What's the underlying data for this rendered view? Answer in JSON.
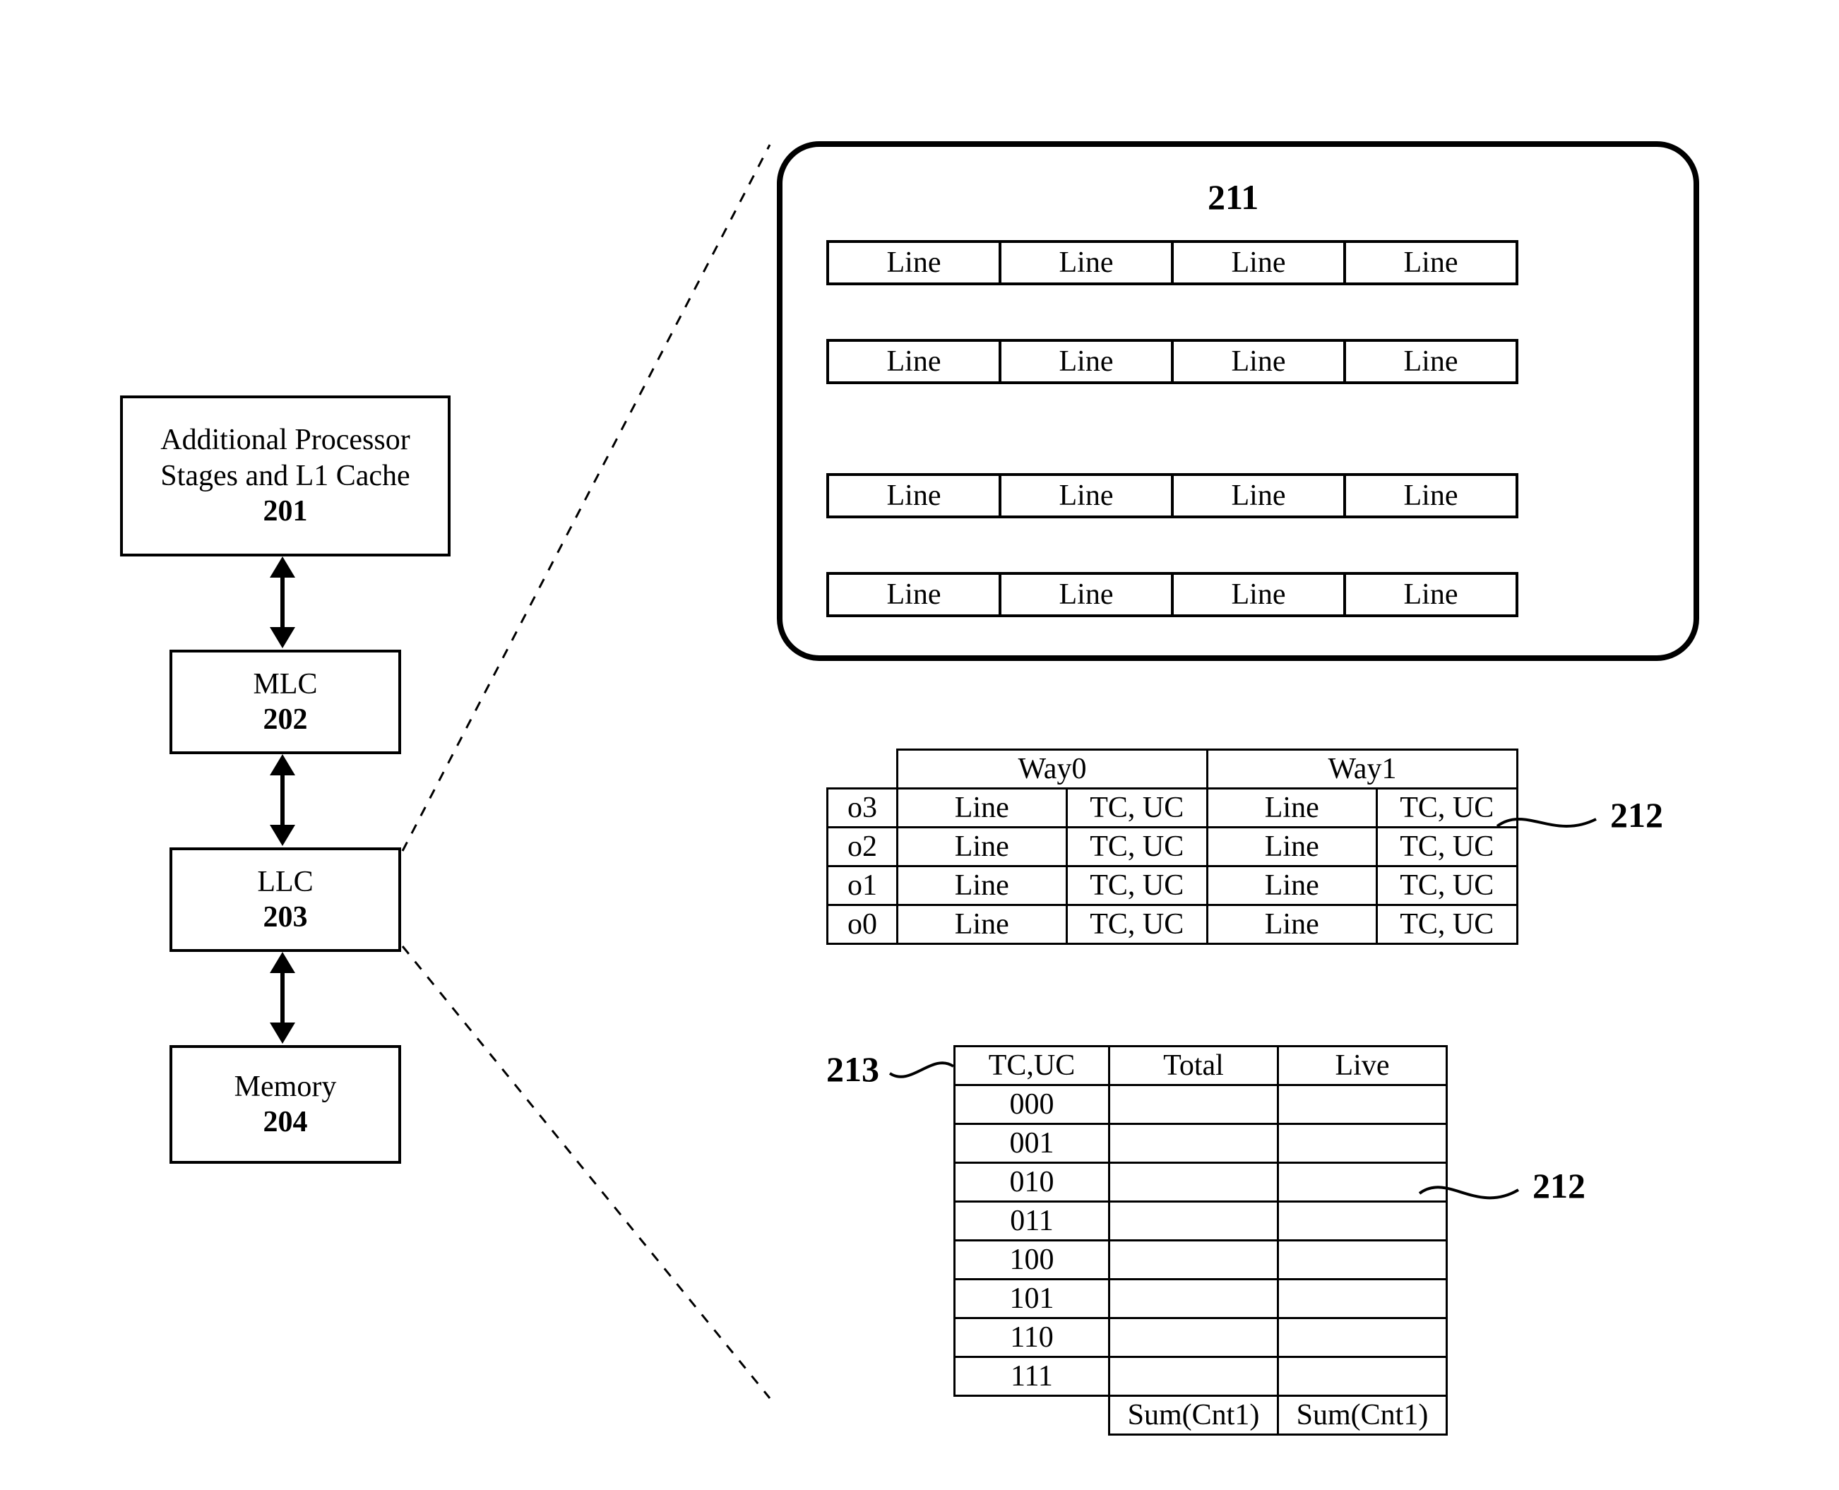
{
  "blocks": {
    "b201": {
      "line1": "Additional Processor",
      "line2": "Stages and L1 Cache",
      "num": "201"
    },
    "b202": {
      "line1": "MLC",
      "num": "202"
    },
    "b203": {
      "line1": "LLC",
      "num": "203"
    },
    "b204": {
      "line1": "Memory",
      "num": "204"
    }
  },
  "detail211": {
    "num": "211",
    "cell": "Line"
  },
  "table212a": {
    "way0": "Way0",
    "way1": "Way1",
    "rows": [
      "o3",
      "o2",
      "o1",
      "o0"
    ],
    "line": "Line",
    "tcuc": "TC, UC"
  },
  "callout212": "212",
  "callout212b": "212",
  "callout213": "213",
  "table213": {
    "h_tcuc": "TC,UC",
    "h_total": "Total",
    "h_live": "Live",
    "codes": [
      "000",
      "001",
      "010",
      "011",
      "100",
      "101",
      "110",
      "111"
    ],
    "sum": "Sum(Cnt1)"
  }
}
